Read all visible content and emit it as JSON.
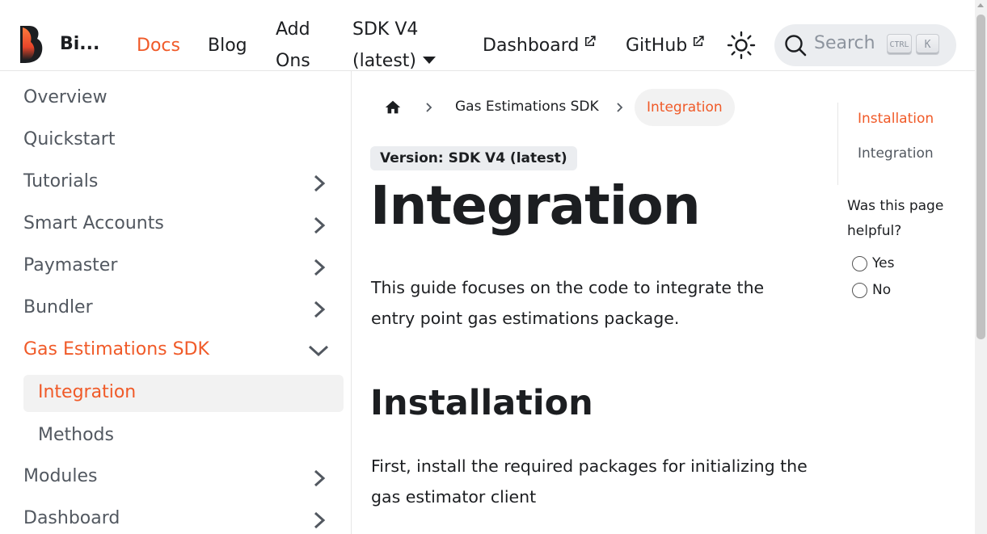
{
  "navbar": {
    "brand": "Bi...",
    "links": {
      "docs": "Docs",
      "blog": "Blog",
      "addons_line1": "Add",
      "addons_line2": "Ons",
      "sdk_line1": "SDK V4",
      "sdk_line2": "(latest)",
      "dashboard": "Dashboard",
      "github": "GitHub"
    },
    "search": {
      "placeholder": "Search",
      "key1": "CTRL",
      "key2": "K"
    }
  },
  "sidebar": {
    "items": [
      {
        "label": "Overview"
      },
      {
        "label": "Quickstart"
      },
      {
        "label": "Tutorials"
      },
      {
        "label": "Smart Accounts"
      },
      {
        "label": "Paymaster"
      },
      {
        "label": "Bundler"
      },
      {
        "label": "Gas Estimations SDK"
      },
      {
        "label": "Modules"
      },
      {
        "label": "Dashboard"
      }
    ],
    "subitems": [
      {
        "label": "Integration"
      },
      {
        "label": "Methods"
      }
    ]
  },
  "breadcrumb": {
    "section": "Gas Estimations SDK",
    "current": "Integration"
  },
  "content": {
    "version_badge": "Version: SDK V4 (latest)",
    "title": "Integration",
    "intro": "This guide focuses on the code to integrate the entry point gas estimations package.",
    "h2_installation": "Installation",
    "install_text": "First, install the required packages for initializing the gas estimator client"
  },
  "toc": {
    "items": [
      {
        "label": "Installation"
      },
      {
        "label": "Integration"
      }
    ]
  },
  "feedback": {
    "question": "Was this page helpful?",
    "yes": "Yes",
    "no": "No"
  },
  "colors": {
    "accent": "#f05a28",
    "text": "#1c1e21",
    "muted": "#525860"
  }
}
